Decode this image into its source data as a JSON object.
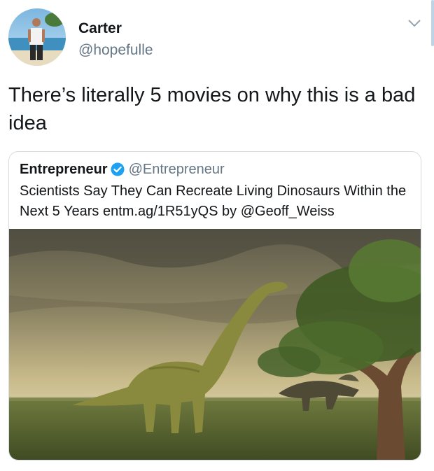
{
  "author": {
    "name": "Carter",
    "handle": "@hopefulle",
    "avatar_icon": "avatar-photo-icon"
  },
  "tweet": {
    "text": "There’s literally 5 movies on why this is a bad idea"
  },
  "quoted_tweet": {
    "name": "Entrepreneur",
    "handle": "@Entrepreneur",
    "verified": true,
    "text": "Scientists Say They Can Recreate Living Dinosaurs Within the Next 5 Years entm.ag/1R51yQS by @Geoff_Weiss",
    "image_icon": "dinosaur-scene-image"
  },
  "colors": {
    "text_primary": "#14171a",
    "text_secondary": "#657786",
    "verified_blue": "#1da1f2",
    "border": "#d6dce1"
  },
  "icons": {
    "menu": "chevron-down-icon",
    "verified": "verified-badge-icon"
  }
}
